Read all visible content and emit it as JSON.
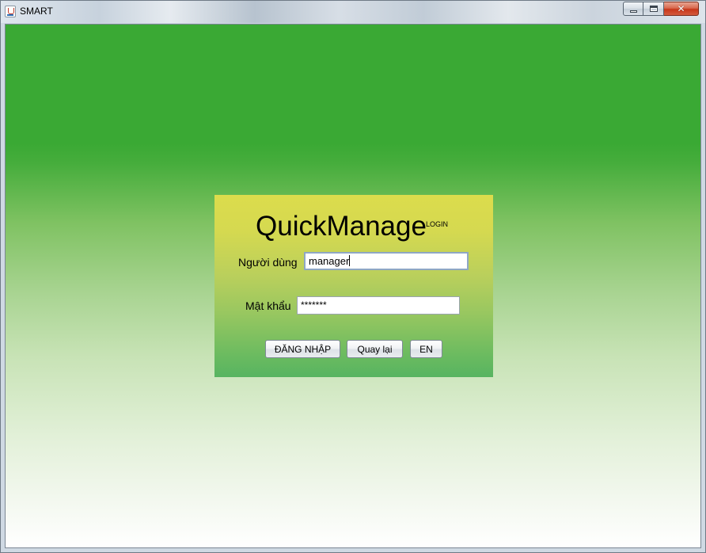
{
  "window": {
    "title": "SMART",
    "minimize_icon": "minimize-icon",
    "maximize_icon": "maximize-icon",
    "close_icon": "close-icon",
    "close_symbol": "✕"
  },
  "login": {
    "app_name": "QuickManage",
    "tag": "LOGIN",
    "username_label": "Người dùng",
    "username_value": "manager",
    "password_label": "Mật khẩu",
    "password_value": "*******",
    "login_button": "ĐĂNG NHẬP",
    "back_button": "Quay lại",
    "language_button": "EN"
  },
  "colors": {
    "background_top": "#3aa934",
    "background_bottom": "#ffffff",
    "panel_top": "#dcdc4c",
    "panel_bottom": "#57b461"
  }
}
